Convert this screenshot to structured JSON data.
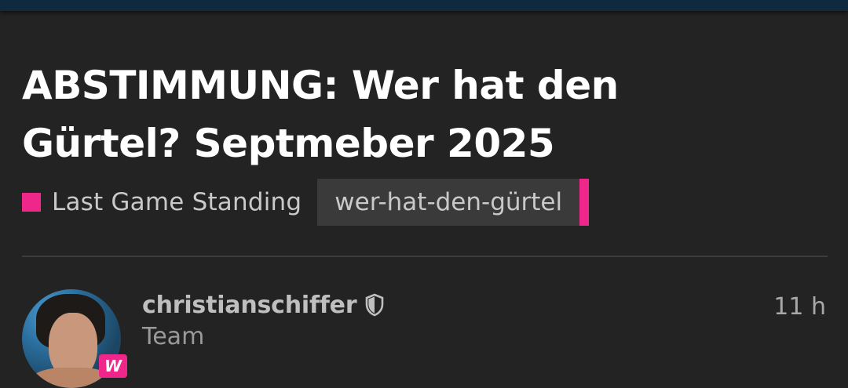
{
  "topic": {
    "title": "ABSTIMMUNG: Wer hat den Gürtel? Septmeber 2025",
    "category": {
      "name": "Last Game Standing",
      "color": "#f0278a"
    },
    "tag": {
      "name": "wer-hat-den-gürtel",
      "color": "#f0278a"
    }
  },
  "post": {
    "author": {
      "username": "christianschiffer",
      "title": "Team",
      "moderator_icon": "shield-icon",
      "avatar_badge": {
        "letter": "W",
        "color": "#f0278a"
      }
    },
    "age": "11 h"
  }
}
